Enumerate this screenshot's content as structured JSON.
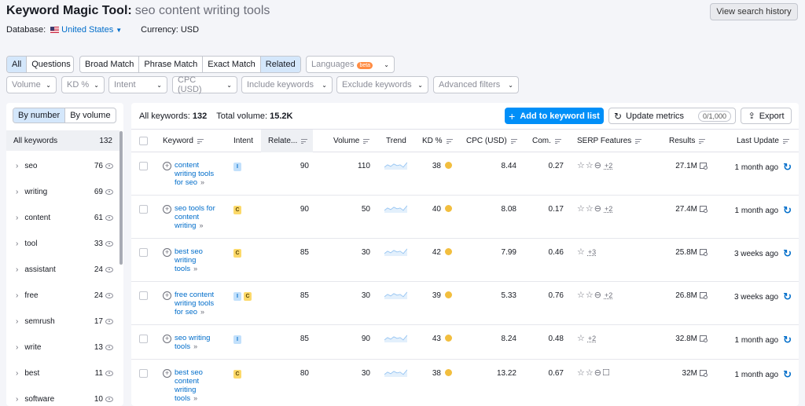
{
  "header": {
    "title": "Keyword Magic Tool:",
    "query": "seo content writing tools",
    "history_button": "View search history",
    "database_label": "Database:",
    "database_value": "United States",
    "currency_label": "Currency: USD"
  },
  "match_tabs": [
    "All",
    "Questions"
  ],
  "type_tabs": [
    "Broad Match",
    "Phrase Match",
    "Exact Match",
    "Related"
  ],
  "languages": {
    "label": "Languages",
    "badge": "beta"
  },
  "filters": [
    "Volume",
    "KD %",
    "Intent",
    "CPC (USD)",
    "Include keywords",
    "Exclude keywords",
    "Advanced filters"
  ],
  "sidebar": {
    "toggle": [
      "By number",
      "By volume"
    ],
    "all_label": "All keywords",
    "all_count": "132",
    "groups": [
      {
        "label": "seo",
        "count": "76"
      },
      {
        "label": "writing",
        "count": "69"
      },
      {
        "label": "content",
        "count": "61"
      },
      {
        "label": "tool",
        "count": "33"
      },
      {
        "label": "assistant",
        "count": "24"
      },
      {
        "label": "free",
        "count": "24"
      },
      {
        "label": "semrush",
        "count": "17"
      },
      {
        "label": "write",
        "count": "13"
      },
      {
        "label": "best",
        "count": "11"
      },
      {
        "label": "software",
        "count": "10"
      }
    ]
  },
  "summary": {
    "all_label": "All keywords:",
    "all_value": "132",
    "volume_label": "Total volume:",
    "volume_value": "15.2K"
  },
  "actions": {
    "add": "Add to keyword list",
    "update": "Update metrics",
    "update_count": "0/1,000",
    "export": "Export"
  },
  "columns": [
    "Keyword",
    "Intent",
    "Relate...",
    "Volume",
    "Trend",
    "KD %",
    "CPC (USD)",
    "Com.",
    "SERP Features",
    "Results",
    "Last Update"
  ],
  "rows": [
    {
      "keyword": "content writing tools for seo",
      "intent": [
        "I"
      ],
      "related": "90",
      "volume": "110",
      "kd": "38",
      "cpc": "8.44",
      "com": "0.27",
      "serp_icons": "☆☆⊖",
      "serp_extra": "+2",
      "results": "27.1M",
      "updated": "1 month ago"
    },
    {
      "keyword": "seo tools for content writing",
      "intent": [
        "C"
      ],
      "related": "90",
      "volume": "50",
      "kd": "40",
      "cpc": "8.08",
      "com": "0.17",
      "serp_icons": "☆☆⊖",
      "serp_extra": "+2",
      "results": "27.4M",
      "updated": "1 month ago"
    },
    {
      "keyword": "best seo writing tools",
      "intent": [
        "C"
      ],
      "related": "85",
      "volume": "30",
      "kd": "42",
      "cpc": "7.99",
      "com": "0.46",
      "serp_icons": "☆",
      "serp_extra": "+3",
      "results": "25.8M",
      "updated": "3 weeks ago"
    },
    {
      "keyword": "free content writing tools for seo",
      "intent": [
        "I",
        "C"
      ],
      "related": "85",
      "volume": "30",
      "kd": "39",
      "cpc": "5.33",
      "com": "0.76",
      "serp_icons": "☆☆⊖",
      "serp_extra": "+2",
      "results": "26.8M",
      "updated": "3 weeks ago"
    },
    {
      "keyword": "seo writing tools",
      "intent": [
        "I"
      ],
      "related": "85",
      "volume": "90",
      "kd": "43",
      "cpc": "8.24",
      "com": "0.48",
      "serp_icons": "☆",
      "serp_extra": "+2",
      "results": "32.8M",
      "updated": "1 month ago"
    },
    {
      "keyword": "best seo content writing tools",
      "intent": [
        "C"
      ],
      "related": "80",
      "volume": "30",
      "kd": "38",
      "cpc": "13.22",
      "com": "0.67",
      "serp_icons": "☆☆⊖☐",
      "serp_extra": "",
      "results": "32M",
      "updated": "1 month ago"
    }
  ],
  "colors": {
    "accent": "#008ff8",
    "link": "#006dca",
    "kd_dot": "#f2be3e"
  }
}
